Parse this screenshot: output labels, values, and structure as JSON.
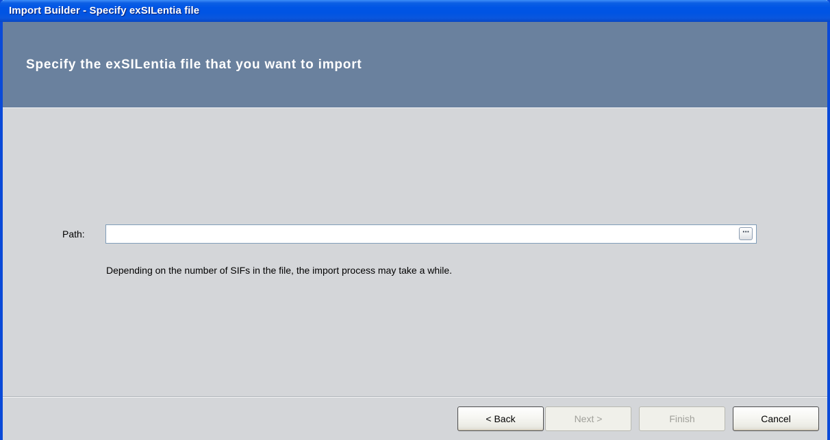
{
  "window": {
    "title": "Import Builder - Specify exSILentia file"
  },
  "header": {
    "title": "Specify the exSILentia file that you want to import"
  },
  "form": {
    "path_label": "Path:",
    "path_value": "",
    "path_placeholder": "",
    "browse_glyph": "···",
    "hint": "Depending on the number of SIFs in the file, the import process may take a while."
  },
  "footer": {
    "back_label": "< Back",
    "next_label": "Next >",
    "finish_label": "Finish",
    "cancel_label": "Cancel"
  },
  "colors": {
    "titlebar": "#0054e3",
    "header_bg": "#6a819e",
    "body_bg": "#d4d6d9"
  },
  "icons": {
    "browse": "ellipsis-icon"
  }
}
